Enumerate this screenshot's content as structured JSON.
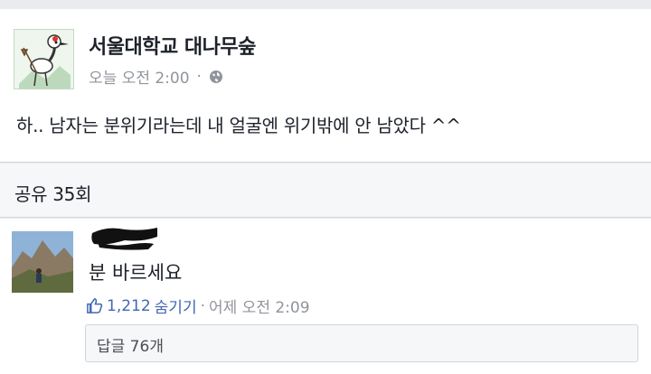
{
  "post": {
    "page_name": "서울대학교 대나무숲",
    "time": "오늘 오전 2:00",
    "separator": "·",
    "text": "하.. 남자는 분위기라는데 내 얼굴엔 위기밖에 안 남았다 ^^"
  },
  "shares": {
    "label": "공유 35회"
  },
  "comment": {
    "text": "분 바르세요",
    "like_count": "1,212",
    "hide_label": "숨기기",
    "separator": "·",
    "time": "어제 오전 2:09",
    "reply_label": "답글 76개"
  },
  "colors": {
    "link": "#4267b2",
    "meta": "#90949c",
    "text": "#1d2129"
  },
  "icons": {
    "privacy": "globe-icon",
    "like": "thumbs-up-icon"
  }
}
